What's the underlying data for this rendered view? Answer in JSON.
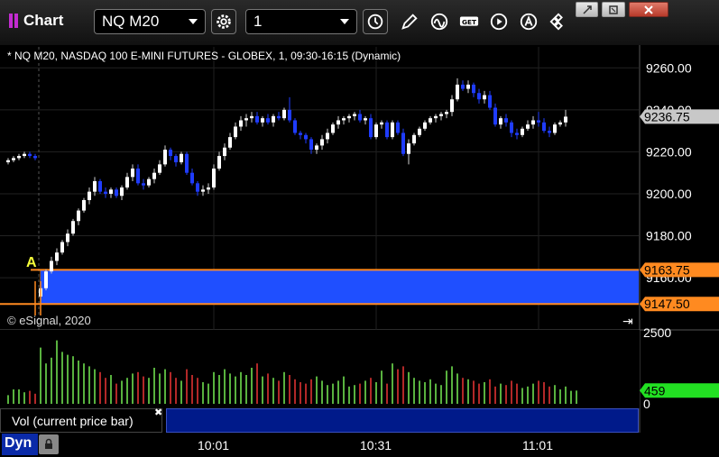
{
  "toolbar": {
    "app_title": "Chart",
    "symbol": "NQ M20",
    "interval": "1",
    "icons": [
      "settings-gear-icon",
      "clock-icon",
      "pencil-icon",
      "study-wave-icon",
      "get-icon",
      "play-icon",
      "alert-a-icon",
      "move-icon"
    ]
  },
  "window_buttons": [
    "restore-icon",
    "minimize-box-icon",
    "close-x-icon"
  ],
  "chart_data": [
    {
      "type": "candlestick",
      "title": "* NQ M20, NASDAQ 100 E-MINI FUTURES - GLOBEX, 1, 09:30-16:15 (Dynamic)",
      "ylim": [
        9142,
        9270
      ],
      "yticks": [
        "9260.00",
        "9240.00",
        "9220.00",
        "9200.00",
        "9180.00",
        "9160.00"
      ],
      "ytick_values": [
        9260,
        9240,
        9220,
        9200,
        9180,
        9160
      ],
      "xticks": [
        "10:01",
        "10:31",
        "11:01"
      ],
      "xtick_bar_index": [
        38,
        68,
        98
      ],
      "grid": true,
      "last_price_label": "9236.75",
      "last_price": 9236.75,
      "marker_label": "A",
      "marker_bar_index": 7,
      "range_band": {
        "high": 9163.75,
        "low": 9147.5,
        "high_label": "9163.75",
        "low_label": "9147.50",
        "color": "#1f4fff"
      },
      "series": [
        {
          "o": 9215,
          "h": 9217,
          "l": 9214,
          "c": 9216
        },
        {
          "o": 9216,
          "h": 9218,
          "l": 9215,
          "c": 9217
        },
        {
          "o": 9217,
          "h": 9219,
          "l": 9216,
          "c": 9218
        },
        {
          "o": 9218,
          "h": 9220,
          "l": 9217,
          "c": 9219
        },
        {
          "o": 9219,
          "h": 9220,
          "l": 9217,
          "c": 9218
        },
        {
          "o": 9218,
          "h": 9219,
          "l": 9216,
          "c": 9217
        },
        {
          "o": 9151,
          "h": 9156,
          "l": 9148,
          "c": 9155
        },
        {
          "o": 9155,
          "h": 9164,
          "l": 9154,
          "c": 9163
        },
        {
          "o": 9163,
          "h": 9170,
          "l": 9162,
          "c": 9168
        },
        {
          "o": 9168,
          "h": 9174,
          "l": 9166,
          "c": 9172
        },
        {
          "o": 9172,
          "h": 9178,
          "l": 9171,
          "c": 9177
        },
        {
          "o": 9177,
          "h": 9183,
          "l": 9175,
          "c": 9181
        },
        {
          "o": 9181,
          "h": 9188,
          "l": 9180,
          "c": 9187
        },
        {
          "o": 9187,
          "h": 9193,
          "l": 9185,
          "c": 9192
        },
        {
          "o": 9192,
          "h": 9198,
          "l": 9191,
          "c": 9197
        },
        {
          "o": 9197,
          "h": 9203,
          "l": 9195,
          "c": 9201
        },
        {
          "o": 9201,
          "h": 9208,
          "l": 9199,
          "c": 9206
        },
        {
          "o": 9206,
          "h": 9207,
          "l": 9200,
          "c": 9201
        },
        {
          "o": 9201,
          "h": 9203,
          "l": 9198,
          "c": 9200
        },
        {
          "o": 9200,
          "h": 9203,
          "l": 9198,
          "c": 9202
        },
        {
          "o": 9202,
          "h": 9203,
          "l": 9198,
          "c": 9199
        },
        {
          "o": 9199,
          "h": 9204,
          "l": 9197,
          "c": 9203
        },
        {
          "o": 9203,
          "h": 9210,
          "l": 9202,
          "c": 9208
        },
        {
          "o": 9208,
          "h": 9214,
          "l": 9206,
          "c": 9212
        },
        {
          "o": 9212,
          "h": 9214,
          "l": 9204,
          "c": 9205
        },
        {
          "o": 9205,
          "h": 9207,
          "l": 9202,
          "c": 9204
        },
        {
          "o": 9204,
          "h": 9208,
          "l": 9203,
          "c": 9207
        },
        {
          "o": 9207,
          "h": 9212,
          "l": 9205,
          "c": 9210
        },
        {
          "o": 9210,
          "h": 9216,
          "l": 9209,
          "c": 9214
        },
        {
          "o": 9214,
          "h": 9223,
          "l": 9213,
          "c": 9221
        },
        {
          "o": 9221,
          "h": 9222,
          "l": 9216,
          "c": 9218
        },
        {
          "o": 9218,
          "h": 9219,
          "l": 9213,
          "c": 9215
        },
        {
          "o": 9215,
          "h": 9220,
          "l": 9214,
          "c": 9219
        },
        {
          "o": 9219,
          "h": 9220,
          "l": 9209,
          "c": 9210
        },
        {
          "o": 9210,
          "h": 9212,
          "l": 9204,
          "c": 9205
        },
        {
          "o": 9205,
          "h": 9206,
          "l": 9199,
          "c": 9201
        },
        {
          "o": 9201,
          "h": 9204,
          "l": 9199,
          "c": 9202
        },
        {
          "o": 9202,
          "h": 9205,
          "l": 9200,
          "c": 9203
        },
        {
          "o": 9203,
          "h": 9214,
          "l": 9202,
          "c": 9212
        },
        {
          "o": 9212,
          "h": 9220,
          "l": 9211,
          "c": 9218
        },
        {
          "o": 9218,
          "h": 9224,
          "l": 9216,
          "c": 9222
        },
        {
          "o": 9222,
          "h": 9229,
          "l": 9221,
          "c": 9227
        },
        {
          "o": 9227,
          "h": 9234,
          "l": 9226,
          "c": 9232
        },
        {
          "o": 9232,
          "h": 9237,
          "l": 9230,
          "c": 9235
        },
        {
          "o": 9235,
          "h": 9238,
          "l": 9232,
          "c": 9236
        },
        {
          "o": 9236,
          "h": 9239,
          "l": 9234,
          "c": 9237
        },
        {
          "o": 9237,
          "h": 9239,
          "l": 9233,
          "c": 9234
        },
        {
          "o": 9234,
          "h": 9237,
          "l": 9232,
          "c": 9236
        },
        {
          "o": 9236,
          "h": 9238,
          "l": 9233,
          "c": 9234
        },
        {
          "o": 9234,
          "h": 9238,
          "l": 9232,
          "c": 9237
        },
        {
          "o": 9237,
          "h": 9239,
          "l": 9235,
          "c": 9236
        },
        {
          "o": 9236,
          "h": 9241,
          "l": 9235,
          "c": 9240
        },
        {
          "o": 9240,
          "h": 9246,
          "l": 9234,
          "c": 9235
        },
        {
          "o": 9235,
          "h": 9236,
          "l": 9228,
          "c": 9229
        },
        {
          "o": 9229,
          "h": 9230,
          "l": 9226,
          "c": 9228
        },
        {
          "o": 9228,
          "h": 9229,
          "l": 9224,
          "c": 9226
        },
        {
          "o": 9226,
          "h": 9227,
          "l": 9219,
          "c": 9221
        },
        {
          "o": 9221,
          "h": 9224,
          "l": 9219,
          "c": 9223
        },
        {
          "o": 9223,
          "h": 9228,
          "l": 9221,
          "c": 9226
        },
        {
          "o": 9226,
          "h": 9231,
          "l": 9224,
          "c": 9229
        },
        {
          "o": 9229,
          "h": 9234,
          "l": 9228,
          "c": 9233
        },
        {
          "o": 9233,
          "h": 9237,
          "l": 9231,
          "c": 9235
        },
        {
          "o": 9235,
          "h": 9237,
          "l": 9233,
          "c": 9236
        },
        {
          "o": 9236,
          "h": 9238,
          "l": 9234,
          "c": 9237
        },
        {
          "o": 9237,
          "h": 9239,
          "l": 9235,
          "c": 9238
        },
        {
          "o": 9238,
          "h": 9240,
          "l": 9234,
          "c": 9235
        },
        {
          "o": 9235,
          "h": 9237,
          "l": 9233,
          "c": 9236
        },
        {
          "o": 9236,
          "h": 9238,
          "l": 9226,
          "c": 9227
        },
        {
          "o": 9227,
          "h": 9234,
          "l": 9226,
          "c": 9233
        },
        {
          "o": 9233,
          "h": 9235,
          "l": 9231,
          "c": 9234
        },
        {
          "o": 9234,
          "h": 9235,
          "l": 9226,
          "c": 9227
        },
        {
          "o": 9227,
          "h": 9235,
          "l": 9226,
          "c": 9234
        },
        {
          "o": 9234,
          "h": 9235,
          "l": 9228,
          "c": 9229
        },
        {
          "o": 9229,
          "h": 9231,
          "l": 9218,
          "c": 9219
        },
        {
          "o": 9219,
          "h": 9226,
          "l": 9214,
          "c": 9224
        },
        {
          "o": 9224,
          "h": 9229,
          "l": 9223,
          "c": 9228
        },
        {
          "o": 9228,
          "h": 9232,
          "l": 9227,
          "c": 9231
        },
        {
          "o": 9231,
          "h": 9235,
          "l": 9230,
          "c": 9234
        },
        {
          "o": 9234,
          "h": 9237,
          "l": 9233,
          "c": 9236
        },
        {
          "o": 9236,
          "h": 9238,
          "l": 9234,
          "c": 9237
        },
        {
          "o": 9237,
          "h": 9239,
          "l": 9235,
          "c": 9238
        },
        {
          "o": 9238,
          "h": 9240,
          "l": 9236,
          "c": 9239
        },
        {
          "o": 9239,
          "h": 9247,
          "l": 9237,
          "c": 9245
        },
        {
          "o": 9245,
          "h": 9255,
          "l": 9244,
          "c": 9252
        },
        {
          "o": 9252,
          "h": 9254,
          "l": 9249,
          "c": 9250
        },
        {
          "o": 9250,
          "h": 9254,
          "l": 9248,
          "c": 9252
        },
        {
          "o": 9252,
          "h": 9253,
          "l": 9246,
          "c": 9248
        },
        {
          "o": 9248,
          "h": 9250,
          "l": 9243,
          "c": 9245
        },
        {
          "o": 9245,
          "h": 9249,
          "l": 9243,
          "c": 9247
        },
        {
          "o": 9247,
          "h": 9249,
          "l": 9240,
          "c": 9241
        },
        {
          "o": 9241,
          "h": 9243,
          "l": 9232,
          "c": 9233
        },
        {
          "o": 9233,
          "h": 9237,
          "l": 9231,
          "c": 9236
        },
        {
          "o": 9236,
          "h": 9238,
          "l": 9232,
          "c": 9234
        },
        {
          "o": 9234,
          "h": 9235,
          "l": 9227,
          "c": 9229
        },
        {
          "o": 9229,
          "h": 9231,
          "l": 9226,
          "c": 9228
        },
        {
          "o": 9228,
          "h": 9232,
          "l": 9227,
          "c": 9231
        },
        {
          "o": 9231,
          "h": 9235,
          "l": 9230,
          "c": 9233
        },
        {
          "o": 9233,
          "h": 9237,
          "l": 9231,
          "c": 9235
        },
        {
          "o": 9235,
          "h": 9239,
          "l": 9232,
          "c": 9234
        },
        {
          "o": 9234,
          "h": 9236,
          "l": 9229,
          "c": 9230
        },
        {
          "o": 9230,
          "h": 9232,
          "l": 9227,
          "c": 9229
        },
        {
          "o": 9229,
          "h": 9234,
          "l": 9228,
          "c": 9233
        },
        {
          "o": 9233,
          "h": 9235,
          "l": 9232,
          "c": 9234
        },
        {
          "o": 9234,
          "h": 9240,
          "l": 9232,
          "c": 9236.75
        }
      ]
    },
    {
      "type": "bar",
      "title": "Vol (current price bar)",
      "ylim": [
        0,
        2500
      ],
      "yticks": [
        "2500",
        "0"
      ],
      "ytick_values": [
        2500,
        0
      ],
      "last_value_label": "459",
      "last_value": 459,
      "values": [
        300,
        500,
        500,
        400,
        450,
        350,
        1950,
        1400,
        1600,
        2200,
        1800,
        1700,
        1650,
        1500,
        1400,
        1300,
        1200,
        1100,
        900,
        1000,
        700,
        800,
        900,
        1050,
        1100,
        950,
        900,
        1250,
        1050,
        1200,
        1100,
        900,
        800,
        1200,
        1000,
        900,
        750,
        700,
        1100,
        1000,
        1200,
        1050,
        950,
        1100,
        1000,
        1250,
        1400,
        950,
        1050,
        900,
        800,
        1100,
        1000,
        850,
        750,
        700,
        850,
        950,
        800,
        650,
        700,
        800,
        950,
        600,
        650,
        700,
        800,
        900,
        750,
        1150,
        700,
        1400,
        1200,
        1300,
        1100,
        900,
        800,
        750,
        850,
        700,
        650,
        1150,
        1300,
        1050,
        900,
        850,
        800,
        700,
        750,
        850,
        600,
        700,
        650,
        800,
        700,
        550,
        600,
        700,
        800,
        750,
        600,
        650,
        500,
        600,
        450,
        459
      ],
      "colors": [
        "#ff3a3a",
        "#7fff5a"
      ]
    }
  ]
}
